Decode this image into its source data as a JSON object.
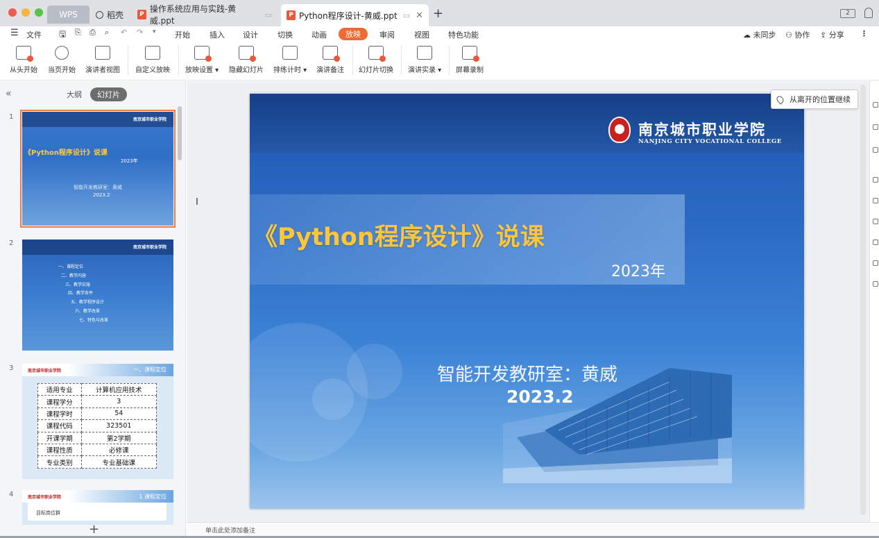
{
  "titlebar": {
    "traffic_colors": [
      "#ee5b52",
      "#f4b73b",
      "#56c446"
    ],
    "tabs": [
      {
        "label": "WPS"
      },
      {
        "label": "稻壳"
      },
      {
        "label": "操作系统应用与实践-黄威.ppt"
      },
      {
        "label": "Python程序设计-黄威.ppt"
      }
    ],
    "new_tab_glyph": "+",
    "window_badge": "2"
  },
  "menubar": {
    "file_label": "文件",
    "items": [
      "开始",
      "插入",
      "设计",
      "切换",
      "动画",
      "放映",
      "审阅",
      "视图",
      "特色功能"
    ],
    "active_item": "放映",
    "accent_color": "#ef6a32",
    "sync_label": "未同步",
    "collab_label": "协作",
    "share_label": "分享"
  },
  "ribbon": {
    "buttons": [
      {
        "label": "从头开始",
        "icon": "play-from-start-icon"
      },
      {
        "label": "当页开始",
        "icon": "play-current-icon"
      },
      {
        "label": "演讲者视图",
        "icon": "presenter-view-icon"
      },
      {
        "label": "自定义放映",
        "icon": "custom-show-icon"
      },
      {
        "label": "放映设置",
        "icon": "show-settings-icon",
        "dropdown": true
      },
      {
        "label": "隐藏幻灯片",
        "icon": "hide-slide-icon"
      },
      {
        "label": "排练计时",
        "icon": "rehearse-timing-icon",
        "dropdown": true
      },
      {
        "label": "演讲备注",
        "icon": "speaker-notes-icon"
      },
      {
        "label": "幻灯片切换",
        "icon": "slide-switch-icon"
      },
      {
        "label": "演讲实录",
        "icon": "record-icon",
        "dropdown": true
      },
      {
        "label": "屏幕录制",
        "icon": "screen-record-icon"
      }
    ]
  },
  "leftpanel": {
    "outline_tab": "大纲",
    "slides_tab": "幻灯片",
    "slide_numbers": [
      "1",
      "2",
      "3",
      "4"
    ],
    "slide2_items": [
      "一、课程定位",
      "二、教学内容",
      "三、教学实施",
      "四、教学条件",
      "五、教学程序设计",
      "六、教学改革",
      "七、特色与改革"
    ],
    "slide3": {
      "header": "一、课程定位",
      "rows": [
        [
          "适用专业",
          "计算机应用技术"
        ],
        [
          "课程学分",
          "3"
        ],
        [
          "课程学时",
          "54"
        ],
        [
          "课程代码",
          "323501"
        ],
        [
          "开课学期",
          "第2学期"
        ],
        [
          "课程性质",
          "必修课"
        ],
        [
          "专业类别",
          "专业基础课"
        ]
      ]
    },
    "slide4": {
      "header": "1 课程定位",
      "sub": "目标岗位群"
    }
  },
  "slide": {
    "college_cn": "南京城市职业学院",
    "college_en": "NANJING CITY VOCATIONAL COLLEGE",
    "title": "《Python程序设计》说课",
    "year": "2023年",
    "author": "智能开发教研室：黄威",
    "date": "2023.2",
    "title_color": "#ffc63a"
  },
  "resume_button": "从离开的位置继续",
  "notes_placeholder": "单击此处添加备注"
}
